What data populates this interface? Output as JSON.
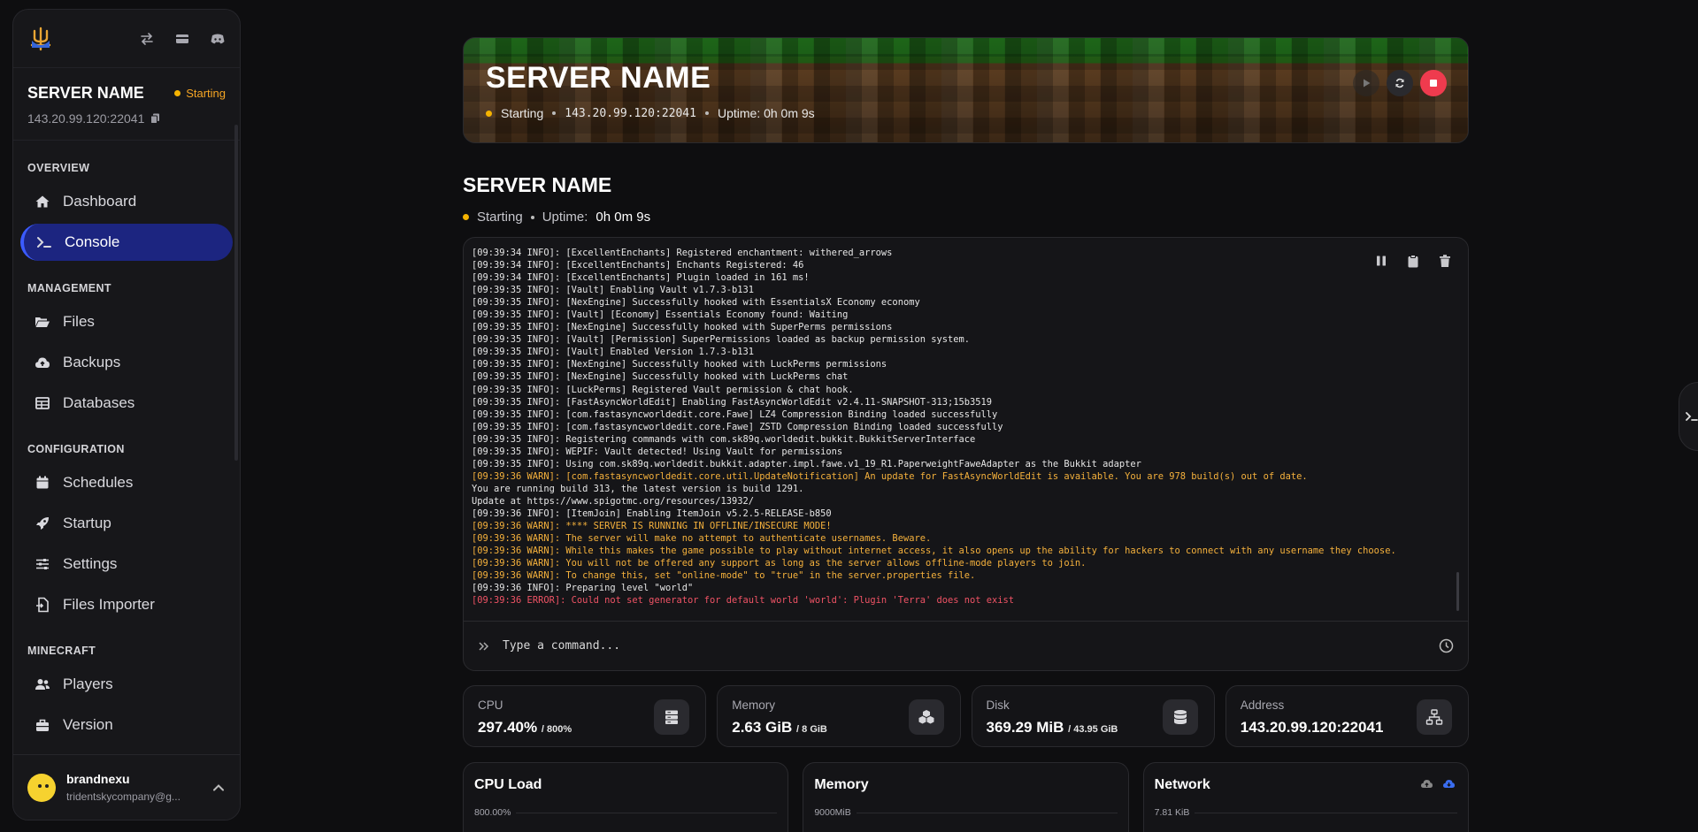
{
  "sidebar": {
    "server_name": "SERVER NAME",
    "status": "Starting",
    "ip": "143.20.99.120:22041",
    "sections": {
      "overview": "OVERVIEW",
      "management": "MANAGEMENT",
      "configuration": "CONFIGURATION",
      "minecraft": "MINECRAFT"
    },
    "items": {
      "dashboard": "Dashboard",
      "console": "Console",
      "files": "Files",
      "backups": "Backups",
      "databases": "Databases",
      "schedules": "Schedules",
      "startup": "Startup",
      "settings": "Settings",
      "files_importer": "Files Importer",
      "players": "Players",
      "version": "Version"
    },
    "user": {
      "name": "brandnexu",
      "email": "tridentskycompany@g..."
    }
  },
  "banner": {
    "title": "SERVER NAME",
    "status": "Starting",
    "ip": "143.20.99.120:22041",
    "uptime": "Uptime: 0h 0m 9s"
  },
  "header": {
    "title": "SERVER NAME",
    "status": "Starting",
    "uptime_label": "Uptime:",
    "uptime_value": "0h 0m 9s"
  },
  "console": {
    "placeholder": "Type a command...",
    "lines": [
      {
        "t": "i",
        "text": "[09:39:34 INFO]: [ExcellentEnchants] Registered enchantment: withered_arrows"
      },
      {
        "t": "i",
        "text": "[09:39:34 INFO]: [ExcellentEnchants] Enchants Registered: 46"
      },
      {
        "t": "i",
        "text": "[09:39:34 INFO]: [ExcellentEnchants] Plugin loaded in 161 ms!"
      },
      {
        "t": "i",
        "text": "[09:39:35 INFO]: [Vault] Enabling Vault v1.7.3-b131"
      },
      {
        "t": "i",
        "text": "[09:39:35 INFO]: [NexEngine] Successfully hooked with EssentialsX Economy economy"
      },
      {
        "t": "i",
        "text": "[09:39:35 INFO]: [Vault] [Economy] Essentials Economy found: Waiting"
      },
      {
        "t": "i",
        "text": "[09:39:35 INFO]: [NexEngine] Successfully hooked with SuperPerms permissions"
      },
      {
        "t": "i",
        "text": "[09:39:35 INFO]: [Vault] [Permission] SuperPermissions loaded as backup permission system."
      },
      {
        "t": "i",
        "text": "[09:39:35 INFO]: [Vault] Enabled Version 1.7.3-b131"
      },
      {
        "t": "i",
        "text": "[09:39:35 INFO]: [NexEngine] Successfully hooked with LuckPerms permissions"
      },
      {
        "t": "i",
        "text": "[09:39:35 INFO]: [NexEngine] Successfully hooked with LuckPerms chat"
      },
      {
        "t": "i",
        "text": "[09:39:35 INFO]: [LuckPerms] Registered Vault permission & chat hook."
      },
      {
        "t": "i",
        "text": "[09:39:35 INFO]: [FastAsyncWorldEdit] Enabling FastAsyncWorldEdit v2.4.11-SNAPSHOT-313;15b3519"
      },
      {
        "t": "i",
        "text": "[09:39:35 INFO]: [com.fastasyncworldedit.core.Fawe] LZ4 Compression Binding loaded successfully"
      },
      {
        "t": "i",
        "text": "[09:39:35 INFO]: [com.fastasyncworldedit.core.Fawe] ZSTD Compression Binding loaded successfully"
      },
      {
        "t": "i",
        "text": "[09:39:35 INFO]: Registering commands with com.sk89q.worldedit.bukkit.BukkitServerInterface"
      },
      {
        "t": "i",
        "text": "[09:39:35 INFO]: WEPIF: Vault detected! Using Vault for permissions"
      },
      {
        "t": "i",
        "text": "[09:39:35 INFO]: Using com.sk89q.worldedit.bukkit.adapter.impl.fawe.v1_19_R1.PaperweightFaweAdapter as the Bukkit adapter"
      },
      {
        "t": "w",
        "text": "[09:39:36 WARN]: [com.fastasyncworldedit.core.util.UpdateNotification] An update for FastAsyncWorldEdit is available. You are 978 build(s) out of date."
      },
      {
        "t": "i",
        "text": "You are running build 313, the latest version is build 1291."
      },
      {
        "t": "i",
        "text": "Update at https://www.spigotmc.org/resources/13932/"
      },
      {
        "t": "i",
        "text": "[09:39:36 INFO]: [ItemJoin] Enabling ItemJoin v5.2.5-RELEASE-b850"
      },
      {
        "t": "w",
        "text": "[09:39:36 WARN]: **** SERVER IS RUNNING IN OFFLINE/INSECURE MODE!"
      },
      {
        "t": "w",
        "text": "[09:39:36 WARN]: The server will make no attempt to authenticate usernames. Beware."
      },
      {
        "t": "w",
        "text": "[09:39:36 WARN]: While this makes the game possible to play without internet access, it also opens up the ability for hackers to connect with any username they choose."
      },
      {
        "t": "w",
        "text": "[09:39:36 WARN]: You will not be offered any support as long as the server allows offline-mode players to join."
      },
      {
        "t": "w",
        "text": "[09:39:36 WARN]: To change this, set \"online-mode\" to \"true\" in the server.properties file."
      },
      {
        "t": "i",
        "text": "[09:39:36 INFO]: Preparing level \"world\""
      },
      {
        "t": "e",
        "text": "[09:39:36 ERROR]: Could not set generator for default world 'world': Plugin 'Terra' does not exist"
      }
    ]
  },
  "stats": {
    "cpu": {
      "label": "CPU",
      "value": "297.40%",
      "limit": "/ 800%"
    },
    "memory": {
      "label": "Memory",
      "value": "2.63 GiB",
      "limit": "/ 8 GiB"
    },
    "disk": {
      "label": "Disk",
      "value": "369.29 MiB",
      "limit": "/ 43.95 GiB"
    },
    "address": {
      "label": "Address",
      "value": "143.20.99.120:22041"
    }
  },
  "charts": {
    "cpu": {
      "title": "CPU Load",
      "tick": "800.00%"
    },
    "memory": {
      "title": "Memory",
      "tick": "9000MiB"
    },
    "network": {
      "title": "Network",
      "tick": "7.81 KiB"
    }
  },
  "colors": {
    "accent": "#1c2580",
    "status_starting": "#f5b301",
    "stop": "#ef3b4e",
    "warn": "#f5b13c",
    "error": "#f05365"
  }
}
